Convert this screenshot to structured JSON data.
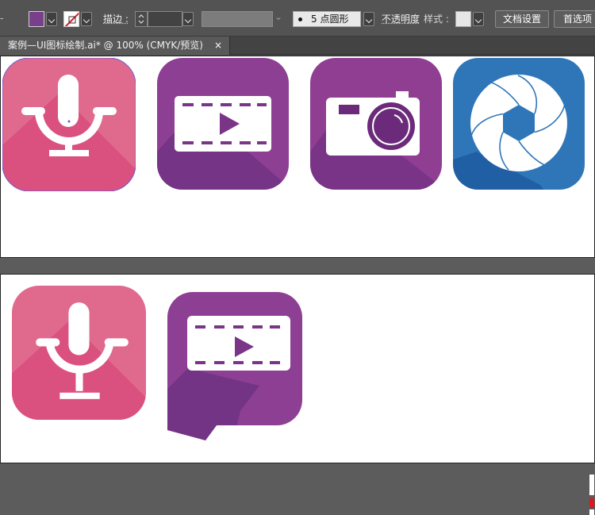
{
  "app": "Adobe Illustrator",
  "control_bar": {
    "fill_color": "#7a3f8b",
    "stroke_label": "描边 :",
    "stroke_value": "",
    "brush_value": "",
    "brush_label": "5 点圆形",
    "opacity_label": "不透明度",
    "style_label": "样式 :",
    "doc_setup_label": "文档设置",
    "prefs_label": "首选项"
  },
  "document": {
    "tab_title": "案例—UI图标绘制.ai* @ 100% (CMYK/预览)",
    "close_glyph": "×"
  },
  "artboard_top": {
    "icons": [
      {
        "name": "microphone",
        "colors": [
          "#e06a8d",
          "#d84c7d"
        ],
        "selected": true
      },
      {
        "name": "video-player",
        "colors": [
          "#8d3f94",
          "#703283"
        ]
      },
      {
        "name": "camera",
        "colors": [
          "#8f3e92",
          "#733284"
        ]
      },
      {
        "name": "aperture",
        "colors": [
          "#2f76b8",
          "#1f5ca0"
        ]
      }
    ]
  },
  "artboard_bottom": {
    "icons": [
      {
        "name": "microphone",
        "colors": [
          "#e06a8d",
          "#d84c7d"
        ]
      },
      {
        "name": "video-speech-bubble",
        "colors": [
          "#8d3f94",
          "#703283"
        ]
      }
    ]
  }
}
